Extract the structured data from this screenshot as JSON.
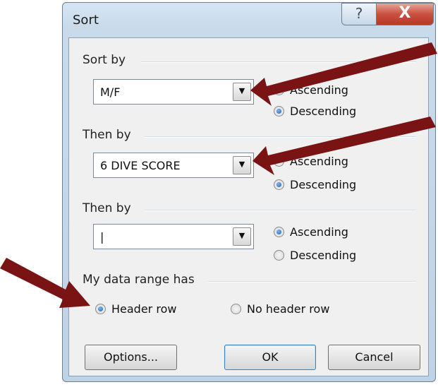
{
  "window": {
    "title": "Sort",
    "help_glyph": "?",
    "close_glyph": "X"
  },
  "sort_by": {
    "label": "Sort by",
    "value": "M/F",
    "order": "Descending",
    "ascending_label": "Ascending",
    "descending_label": "Descending"
  },
  "then_by_1": {
    "label": "Then by",
    "value": "6 DIVE SCORE",
    "order": "Descending",
    "ascending_label": "Ascending",
    "descending_label": "Descending"
  },
  "then_by_2": {
    "label": "Then by",
    "value": "|",
    "order": "Ascending",
    "ascending_label": "Ascending",
    "descending_label": "Descending"
  },
  "data_range": {
    "label": "My data range has",
    "selected": "Header row",
    "header_row_label": "Header row",
    "no_header_row_label": "No header row"
  },
  "buttons": {
    "options": "Options...",
    "ok": "OK",
    "cancel": "Cancel"
  },
  "colors": {
    "arrow": "#7a1414",
    "accent": "#1b5fb4",
    "close": "#c9503e"
  }
}
